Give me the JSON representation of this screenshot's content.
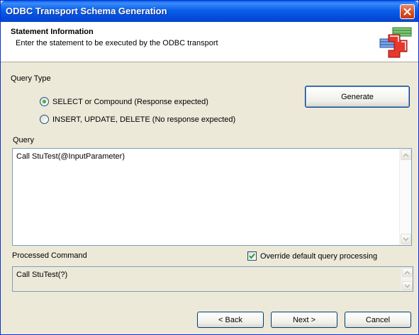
{
  "window": {
    "title": "ODBC Transport Schema Generation"
  },
  "header": {
    "title": "Statement Information",
    "subtitle": "Enter the statement to be executed by the ODBC transport"
  },
  "query_type": {
    "label": "Query Type",
    "options": [
      {
        "label": "SELECT or Compound (Response expected)",
        "checked": true
      },
      {
        "label": "INSERT, UPDATE, DELETE (No response expected)",
        "checked": false
      }
    ],
    "generate_label": "Generate"
  },
  "query": {
    "label": "Query",
    "value": "Call StuTest(@InputParameter)"
  },
  "processed": {
    "label": "Processed Command",
    "override_label": "Override default query processing",
    "override_checked": true,
    "value": "Call StuTest(?)"
  },
  "footer": {
    "back_label": "< Back",
    "next_label": "Next >",
    "cancel_label": "Cancel"
  }
}
